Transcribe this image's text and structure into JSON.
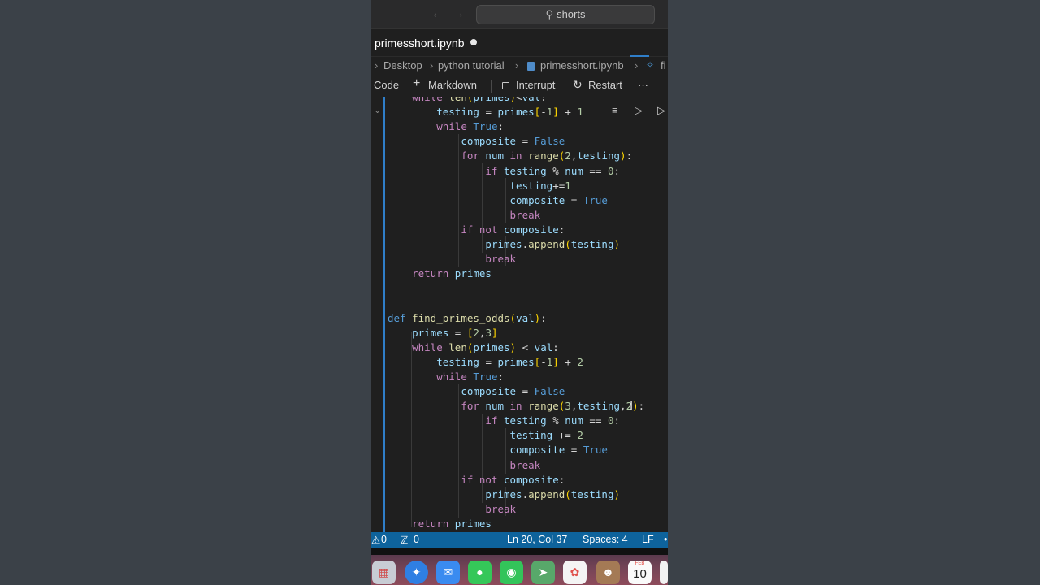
{
  "window": {
    "search_text": "shorts",
    "nav_back_icon": "arrow-left-icon",
    "nav_forward_icon": "arrow-right-icon",
    "search_icon": "search-icon"
  },
  "tab": {
    "title": "primesshort.ipynb",
    "dirty": true
  },
  "breadcrumb": {
    "items": [
      "Desktop",
      "python tutorial",
      "primesshort.ipynb",
      "fi"
    ]
  },
  "toolbar": {
    "code_label": "Code",
    "markdown_label": "Markdown",
    "interrupt_label": "Interrupt",
    "restart_label": "Restart",
    "more_label": "···"
  },
  "editor": {
    "code_lines": [
      "    while len(primes)<val:",
      "        testing = primes[-1] + 1",
      "        while True:",
      "            composite = False",
      "            for num in range(2,testing):",
      "                if testing % num == 0:",
      "                    testing+=1",
      "                    composite = True",
      "                    break",
      "            if not composite:",
      "                primes.append(testing)",
      "                break",
      "    return primes",
      "",
      "",
      "def find_primes_odds(val):",
      "    primes = [2,3]",
      "    while len(primes) < val:",
      "        testing = primes[-1] + 2",
      "        while True:",
      "            composite = False",
      "            for num in range(3,testing,2):",
      "                if testing % num == 0:",
      "                    testing += 2",
      "                    composite = True",
      "                    break",
      "            if not composite:",
      "                primes.append(testing)",
      "                break",
      "    return primes"
    ]
  },
  "statusbar": {
    "errors": "0",
    "warnings": "0",
    "position": "Ln 20, Col 37",
    "spaces": "Spaces: 4",
    "eol": "LF"
  },
  "dock": {
    "items": [
      "launchpad-icon",
      "safari-icon",
      "mail-icon",
      "facetime-icon",
      "messages-icon",
      "maps-icon",
      "photos-icon",
      "contacts-icon",
      "calendar-icon",
      "reminders-icon"
    ],
    "calendar_month": "FEB",
    "calendar_day": "10"
  },
  "colors": {
    "accent": "#0e639c",
    "keyword": "#c586c0",
    "builtin_kw": "#569cd6",
    "function": "#dcdcaa",
    "variable": "#9cdcfe",
    "number": "#b5cea8"
  }
}
